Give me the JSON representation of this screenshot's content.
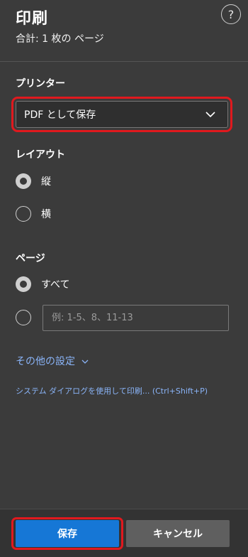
{
  "header": {
    "title": "印刷",
    "subtitle": "合計: 1 枚の ページ",
    "help_label": "?"
  },
  "printer": {
    "label": "プリンター",
    "selected": "PDF として保存",
    "highlight_color": "#e0191e"
  },
  "layout": {
    "label": "レイアウト",
    "options": [
      {
        "label": "縦",
        "checked": true
      },
      {
        "label": "横",
        "checked": false
      }
    ]
  },
  "pages": {
    "label": "ページ",
    "options": [
      {
        "label": "すべて",
        "checked": true
      }
    ],
    "custom_placeholder": "例: 1-5、8、11-13"
  },
  "more_settings": {
    "label": "その他の設定"
  },
  "system_dialog": {
    "label": "システム ダイアログを使用して印刷... (Ctrl+Shift+P)"
  },
  "footer": {
    "save_label": "保存",
    "cancel_label": "キャンセル"
  },
  "colors": {
    "background": "#3b3b3b",
    "accent": "#1677d6",
    "link": "#8ab4f8",
    "highlight": "#e0191e"
  }
}
